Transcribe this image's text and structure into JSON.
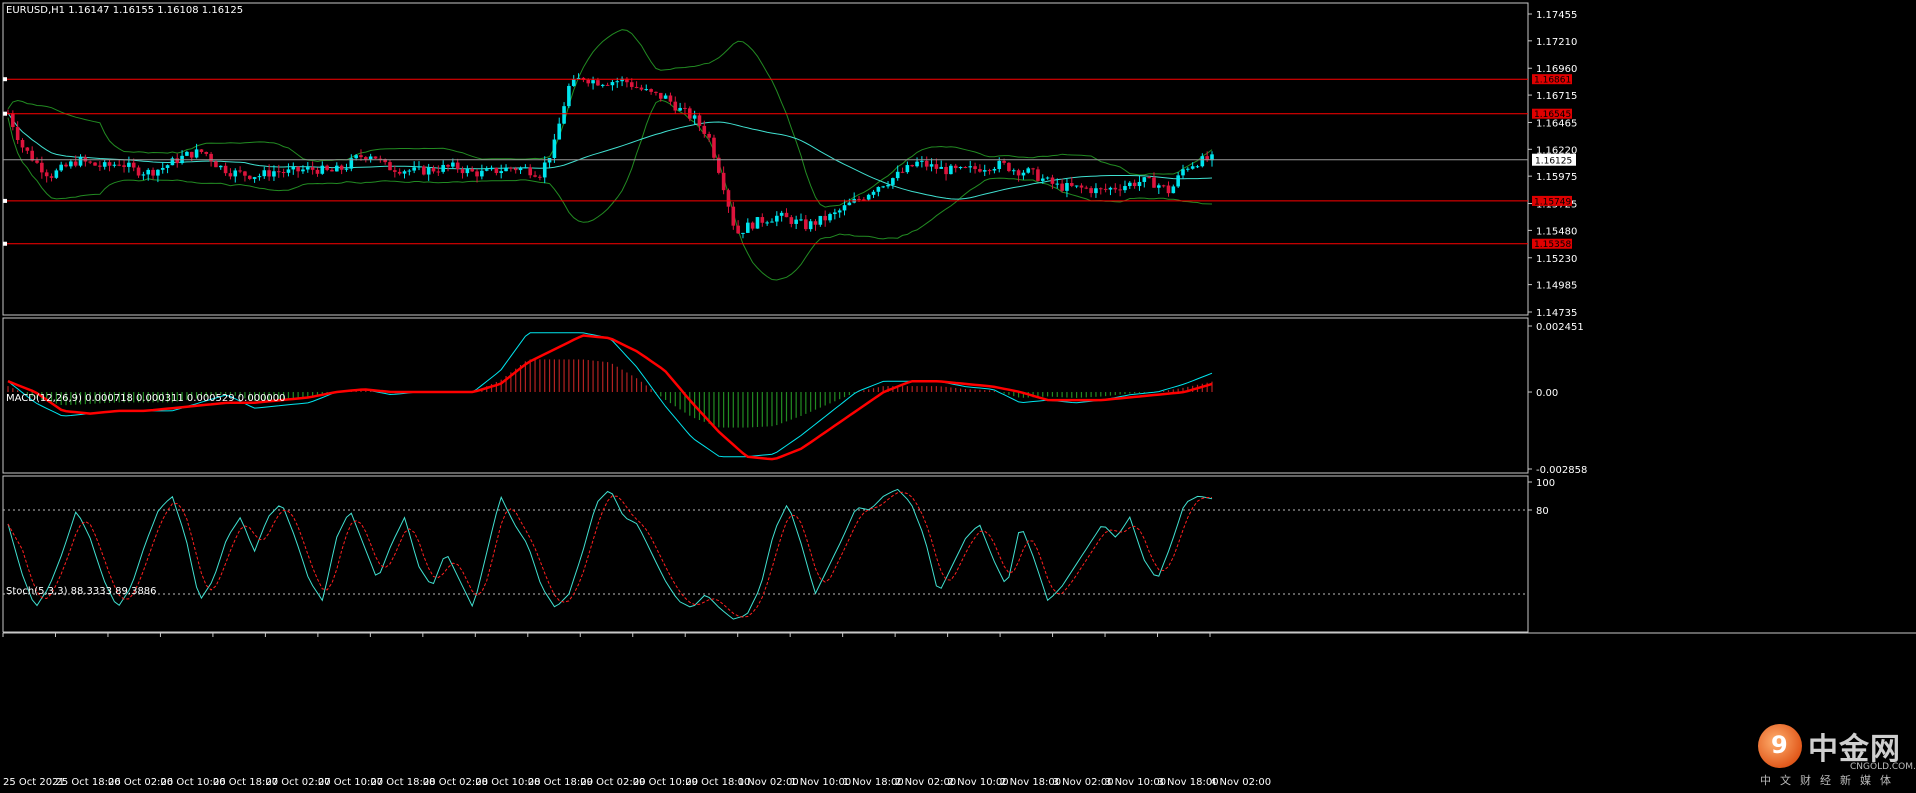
{
  "chart_data": [
    {
      "type": "candlestick",
      "title": "EURUSD,H1  1.16147 1.16155 1.16108 1.16125",
      "symbol": "EURUSD",
      "timeframe": "H1",
      "ohlc_last": {
        "open": 1.16147,
        "high": 1.16155,
        "low": 1.16108,
        "close": 1.16125
      },
      "current_price": "1.16125",
      "ylim": [
        1.14735,
        1.17455
      ],
      "y_ticks": [
        "1.17455",
        "1.17210",
        "1.16960",
        "1.16715",
        "1.16465",
        "1.16220",
        "1.15975",
        "1.15725",
        "1.15480",
        "1.15230",
        "1.14985",
        "1.14735"
      ],
      "x_ticks": [
        "25 Oct 2021",
        "25 Oct 18:00",
        "26 Oct 02:00",
        "26 Oct 10:00",
        "26 Oct 18:00",
        "27 Oct 02:00",
        "27 Oct 10:00",
        "27 Oct 18:00",
        "28 Oct 02:00",
        "28 Oct 10:00",
        "28 Oct 18:00",
        "29 Oct 02:00",
        "29 Oct 10:00",
        "29 Oct 18:00",
        "1 Nov 02:00",
        "1 Nov 10:00",
        "1 Nov 18:00",
        "2 Nov 02:00",
        "2 Nov 10:00",
        "2 Nov 18:00",
        "3 Nov 02:00",
        "3 Nov 10:00",
        "3 Nov 18:00",
        "4 Nov 02:00"
      ],
      "horizontal_levels": [
        {
          "value": 1.1686,
          "label": "1.16861"
        },
        {
          "value": 1.16545,
          "label": "1.16545"
        },
        {
          "value": 1.15749,
          "label": "1.15749"
        },
        {
          "value": 1.15358,
          "label": "1.15358"
        }
      ],
      "close_path": [
        1.1655,
        1.1625,
        1.161,
        1.1598,
        1.1605,
        1.1612,
        1.1608,
        1.1606,
        1.161,
        1.1603,
        1.1601,
        1.1605,
        1.1612,
        1.1618,
        1.162,
        1.1607,
        1.1601,
        1.1599,
        1.1598,
        1.1602,
        1.1601,
        1.1603,
        1.1604,
        1.1601,
        1.1605,
        1.1615,
        1.1618,
        1.1606,
        1.1604,
        1.1602,
        1.1603,
        1.1605,
        1.1606,
        1.1601,
        1.16,
        1.1603,
        1.1605,
        1.1604,
        1.16,
        1.1625,
        1.1678,
        1.1688,
        1.1684,
        1.1684,
        1.1685,
        1.1678,
        1.1672,
        1.1669,
        1.1658,
        1.165,
        1.1635,
        1.1595,
        1.1545,
        1.1553,
        1.1558,
        1.1561,
        1.1557,
        1.1552,
        1.1557,
        1.1562,
        1.1571,
        1.1578,
        1.1588,
        1.1594,
        1.1602,
        1.161,
        1.1606,
        1.1603,
        1.1602,
        1.1604,
        1.1607,
        1.1608,
        1.1603,
        1.1601,
        1.1594,
        1.1588,
        1.1587,
        1.1586,
        1.1584,
        1.1587,
        1.159,
        1.1593,
        1.1591,
        1.1583,
        1.1605,
        1.1611,
        1.1613
      ],
      "indicators": [
        "Bollinger Bands",
        "Moving Average"
      ]
    },
    {
      "type": "macd",
      "title": "MACD(12,26,9) 0.000718 0.000311 0.000529 0.000000",
      "params": [
        12,
        26,
        9
      ],
      "values": {
        "main": 0.000718,
        "signal": 0.000311,
        "histogram": 0.000529,
        "extra": 0.0
      },
      "ylim": [
        -0.002858,
        0.002451
      ],
      "y_ticks": [
        "0.002451",
        "0.00",
        "-0.002858"
      ],
      "macd_path": [
        0.0004,
        -0.0004,
        -0.0009,
        -0.0008,
        -0.0007,
        -0.0007,
        -0.0007,
        -0.0004,
        -0.0001,
        -0.0006,
        -0.0005,
        -0.0004,
        0.0,
        0.0001,
        -0.0001,
        0.0,
        0.0,
        0.0,
        0.0008,
        0.0022,
        0.0022,
        0.0022,
        0.002,
        0.0009,
        -0.0005,
        -0.0017,
        -0.0024,
        -0.0024,
        -0.0023,
        -0.0016,
        -0.0008,
        0.0,
        0.0004,
        0.0004,
        0.0004,
        0.0002,
        0.0001,
        -0.0004,
        -0.0003,
        -0.0004,
        -0.0003,
        -0.0001,
        0.0,
        0.0003,
        0.0007
      ],
      "signal_path": [
        0.0004,
        0.0,
        -0.0007,
        -0.0008,
        -0.0007,
        -0.0007,
        -0.0006,
        -0.0005,
        -0.0004,
        -0.0004,
        -0.0003,
        -0.0002,
        0.0,
        0.0001,
        0.0,
        0.0,
        0.0,
        0.0,
        0.0003,
        0.0011,
        0.0016,
        0.0021,
        0.002,
        0.0015,
        0.0008,
        -0.0004,
        -0.0015,
        -0.0024,
        -0.0025,
        -0.0021,
        -0.0014,
        -0.0007,
        0.0,
        0.0004,
        0.0004,
        0.0003,
        0.0002,
        0.0,
        -0.0003,
        -0.0003,
        -0.0003,
        -0.0002,
        -0.0001,
        0.0,
        0.0003
      ]
    },
    {
      "type": "stochastic",
      "title": "Stoch(5,3,3) 88.3333 89.3886",
      "params": [
        5,
        3,
        3
      ],
      "values": {
        "main": 88.3333,
        "signal": 89.3886
      },
      "ylim": [
        0,
        100
      ],
      "y_ticks": [
        "100",
        "80"
      ],
      "levels": [
        80,
        20
      ],
      "k_path": [
        70,
        35,
        10,
        25,
        50,
        80,
        60,
        30,
        10,
        25,
        55,
        80,
        90,
        60,
        15,
        30,
        60,
        75,
        50,
        75,
        85,
        60,
        30,
        15,
        60,
        80,
        55,
        30,
        55,
        75,
        40,
        25,
        50,
        30,
        10,
        50,
        90,
        70,
        55,
        25,
        10,
        20,
        50,
        85,
        95,
        75,
        70,
        50,
        30,
        15,
        10,
        20,
        10,
        2,
        5,
        25,
        65,
        85,
        55,
        20,
        40,
        60,
        82,
        80,
        90,
        95,
        85,
        60,
        20,
        40,
        60,
        70,
        45,
        25,
        70,
        45,
        15,
        25,
        40,
        55,
        70,
        60,
        75,
        45,
        30,
        55,
        85,
        90,
        88
      ]
    }
  ],
  "logo": {
    "name": "中金网",
    "domain": "CNGOLD.COM.CN",
    "subtitle": "中文财经新媒体",
    "badge_glyph": "9"
  },
  "colors": {
    "background": "#000000",
    "bull_candle": "#00e5ee",
    "bear_candle": "#dc143c",
    "bollinger": "#228b22",
    "moving_average": "#40e0d0",
    "level_line": "#ff0000",
    "macd_main": "#00e5ee",
    "macd_signal": "#ff0000",
    "macd_hist_up": "#b22222",
    "macd_hist_down": "#228b22",
    "stoch_main": "#40e0d0",
    "stoch_signal": "#ff2020"
  }
}
